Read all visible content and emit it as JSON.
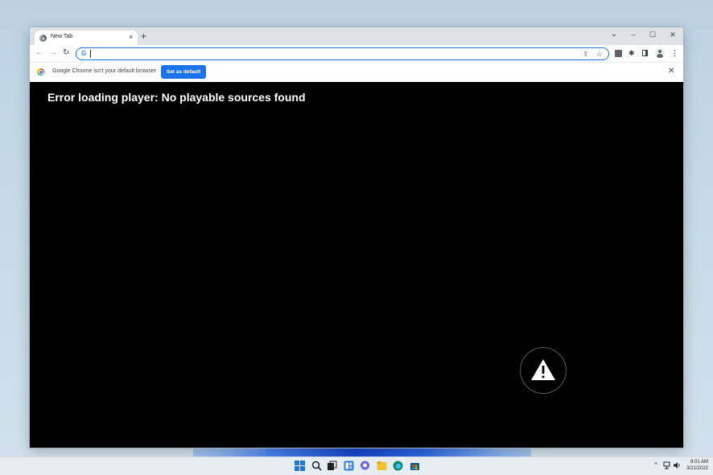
{
  "tab": {
    "title": "New Tab",
    "close_glyph": "×",
    "icon": "globe-icon"
  },
  "tabstrip": {
    "new_tab_glyph": "+",
    "dropdown_glyph": "⌄",
    "minimize_glyph": "–",
    "maximize_glyph": "☐",
    "close_glyph": "✕"
  },
  "toolbar": {
    "back_glyph": "←",
    "forward_glyph": "→",
    "reload_glyph": "↻",
    "omnibox_logo": "G",
    "omnibox_value": "",
    "share_glyph": "⇪",
    "bookmark_glyph": "☆",
    "puzzle_glyph": "✱",
    "menu_glyph": "⋮"
  },
  "infobar": {
    "message": "Google Chrome isn't your default browser",
    "button_label": "Set as default",
    "close_glyph": "✕"
  },
  "player": {
    "error_message": "Error loading player: No playable sources found",
    "warning_icon": "warning-triangle-icon"
  },
  "taskbar": {
    "icons": [
      "windows-start-icon",
      "search-icon",
      "task-view-icon",
      "widgets-icon",
      "chat-icon",
      "file-explorer-icon",
      "edge-icon",
      "store-icon"
    ],
    "tray_chevron": "^",
    "clock_time": "8:01 AM",
    "clock_date": "3/21/2022"
  },
  "colors": {
    "accent": "#1a73e8",
    "player_bg": "#000000",
    "tabstrip_bg": "#dee1e6"
  }
}
